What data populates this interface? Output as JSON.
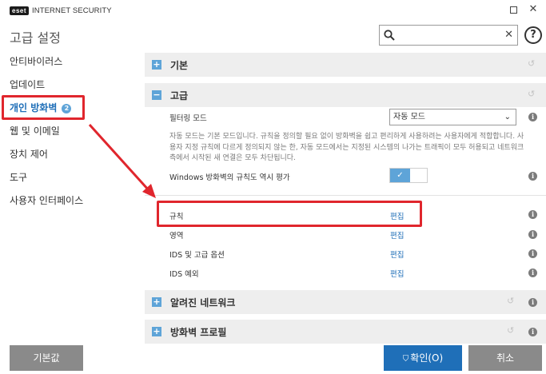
{
  "app": {
    "logo_badge": "eset",
    "logo_text": "INTERNET SECURITY",
    "page_title": "고급 설정"
  },
  "search": {
    "placeholder": "",
    "value": ""
  },
  "help_label": "?",
  "sidebar": {
    "items": [
      {
        "label": "안티바이러스"
      },
      {
        "label": "업데이트"
      },
      {
        "label": "개인 방화벽",
        "badge": "2",
        "active": true
      },
      {
        "label": "웹 및 이메일"
      },
      {
        "label": "장치 제어"
      },
      {
        "label": "도구"
      },
      {
        "label": "사용자 인터페이스"
      }
    ]
  },
  "sections": {
    "basic": {
      "toggle": "+",
      "title": "기본"
    },
    "advanced": {
      "toggle": "−",
      "title": "고급"
    },
    "known_networks": {
      "toggle": "+",
      "title": "알려진 네트워크"
    },
    "profiles": {
      "toggle": "+",
      "title": "방화벽 프로필"
    }
  },
  "advanced": {
    "filtering_mode_label": "필터링 모드",
    "filtering_mode_value": "자동 모드",
    "description": "자동 모드는 기본 모드입니다. 규칙을 정의할 필요 없이 방화벽을 쉽고 편리하게 사용하려는 사용자에게 적합합니다. 사용자 지정 규칙에 다르게 정의되지 않는 한, 자동 모드에서는 지정된 시스템의 나가는 트래픽이 모두 허용되고 네트워크 측에서 시작된 새 연결은 모두 차단됩니다.",
    "windows_rules_label": "Windows 방화벽의 규칙도 역시 평가",
    "windows_rules_enabled": true,
    "toggle_check": "✓",
    "rows": [
      {
        "label": "규칙",
        "link": "편집"
      },
      {
        "label": "영역",
        "link": "편집"
      },
      {
        "label": "IDS 및 고급 옵션",
        "link": "편집"
      },
      {
        "label": "IDS 예외",
        "link": "편집"
      }
    ]
  },
  "icons": {
    "info": "i",
    "undo": "↺",
    "close": "✕",
    "dropdown": "⌄"
  },
  "footer": {
    "default_label": "기본값",
    "ok_label": "확인(O)",
    "cancel_label": "취소"
  },
  "colors": {
    "accent": "#1f6fb8",
    "expander": "#5ea4d8",
    "highlight": "#e0262d",
    "button_gray": "#8a8a8a"
  }
}
